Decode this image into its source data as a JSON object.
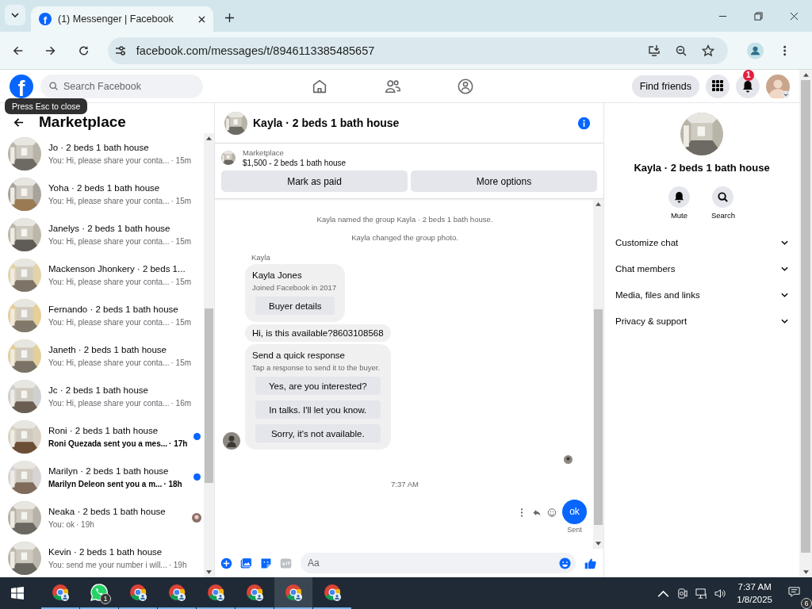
{
  "browser": {
    "tab": {
      "title": "(1) Messenger | Facebook",
      "favicon": "f"
    },
    "url": "facebook.com/messages/t/8946113385485657"
  },
  "header": {
    "logo": "f",
    "search": {
      "placeholder": "Search Facebook"
    },
    "find_friends": "Find friends",
    "notifications": "1"
  },
  "tooltip": "Press Esc to close",
  "sidebar": {
    "title": "Marketplace",
    "items": [
      {
        "name": "Jo · 2 beds 1 bath house",
        "preview": "You: Hi, please share your conta...",
        "time": "· 15m",
        "unread": false,
        "seen": false
      },
      {
        "name": "Yoha · 2 beds 1 bath house",
        "preview": "You: Hi, please share your conta...",
        "time": "· 15m",
        "unread": false,
        "seen": false
      },
      {
        "name": "Janelys · 2 beds 1 bath house",
        "preview": "You: Hi, please share your conta...",
        "time": "· 15m",
        "unread": false,
        "seen": false
      },
      {
        "name": "Mackenson Jhonkery · 2 beds 1...",
        "preview": "You: Hi, please share your conta...",
        "time": "· 15m",
        "unread": false,
        "seen": false
      },
      {
        "name": "Fernando · 2 beds 1 bath house",
        "preview": "You: Hi, please share your conta...",
        "time": "· 15m",
        "unread": false,
        "seen": false
      },
      {
        "name": "Janeth · 2 beds 1 bath house",
        "preview": "You: Hi, please share your conta...",
        "time": "· 15m",
        "unread": false,
        "seen": false
      },
      {
        "name": "Jc · 2 beds 1 bath house",
        "preview": "You: Hi, please share your conta...",
        "time": "· 16m",
        "unread": false,
        "seen": false
      },
      {
        "name": "Roni · 2 beds 1 bath house",
        "preview": "Roni Quezada sent you a mes...",
        "time": "· 17h",
        "unread": true,
        "seen": false
      },
      {
        "name": "Marilyn · 2 beds 1 bath house",
        "preview": "Marilyn Deleon sent you a m...",
        "time": "· 18h",
        "unread": true,
        "seen": false
      },
      {
        "name": "Neaka · 2 beds 1 bath house",
        "preview": "You: ok",
        "time": "· 19h",
        "unread": false,
        "seen": true
      },
      {
        "name": "Kevin · 2 beds 1 bath house",
        "preview": "You: send me your number i will...",
        "time": "· 19h",
        "unread": false,
        "seen": false
      }
    ]
  },
  "chat": {
    "title": "Kayla · 2 beds 1 bath house",
    "listing": {
      "label": "Marketplace",
      "title": "$1,500 - 2 beds 1 bath house"
    },
    "actions": [
      "Mark as paid",
      "More options"
    ],
    "messages": [
      {
        "kind": "system",
        "text": "Kayla named the group Kayla · 2 beds 1 bath house."
      },
      {
        "kind": "system",
        "text": "Kayla changed the group photo."
      },
      {
        "kind": "sender",
        "text": "Kayla"
      },
      {
        "kind": "profile",
        "name": "Kayla Jones",
        "subtitle": "Joined Facebook in 2017",
        "button": "Buyer details",
        "avatar": false
      },
      {
        "kind": "text",
        "text": "Hi, is this available?8603108568",
        "avatar": false
      },
      {
        "kind": "quick",
        "title": "Send a quick response",
        "subtitle": "Tap a response to send it to the buyer.",
        "options": [
          "Yes, are you interested?",
          "In talks. I'll let you know.",
          "Sorry, it's not available."
        ],
        "avatar": true
      },
      {
        "kind": "seen"
      },
      {
        "kind": "time",
        "text": "7:37 AM"
      },
      {
        "kind": "outgoing",
        "text": "ok",
        "status": "Sent"
      }
    ],
    "composer": {
      "placeholder": "Aa"
    }
  },
  "details": {
    "title": "Kayla · 2 beds 1 bath house",
    "actions": [
      {
        "kind": "bell",
        "label": "Mute"
      },
      {
        "kind": "search",
        "label": "Search"
      }
    ],
    "sections": [
      {
        "label": "Customize chat",
        "expanded": false
      },
      {
        "label": "Chat members",
        "expanded": false
      },
      {
        "label": "Media, files and links",
        "expanded": false
      },
      {
        "label": "Privacy & support",
        "expanded": false
      }
    ]
  },
  "taskbar": {
    "apps": [
      {
        "kind": "chrome",
        "selected": false
      },
      {
        "kind": "whatsapp",
        "badge": "1",
        "selected": false
      },
      {
        "kind": "chrome",
        "selected": false
      },
      {
        "kind": "chrome",
        "selected": false
      },
      {
        "kind": "chrome",
        "selected": false
      },
      {
        "kind": "chrome",
        "selected": false
      },
      {
        "kind": "chrome",
        "selected": true
      },
      {
        "kind": "chrome",
        "selected": false
      }
    ],
    "time": "7:37 AM",
    "date": "1/8/2025",
    "notifications": "6"
  }
}
